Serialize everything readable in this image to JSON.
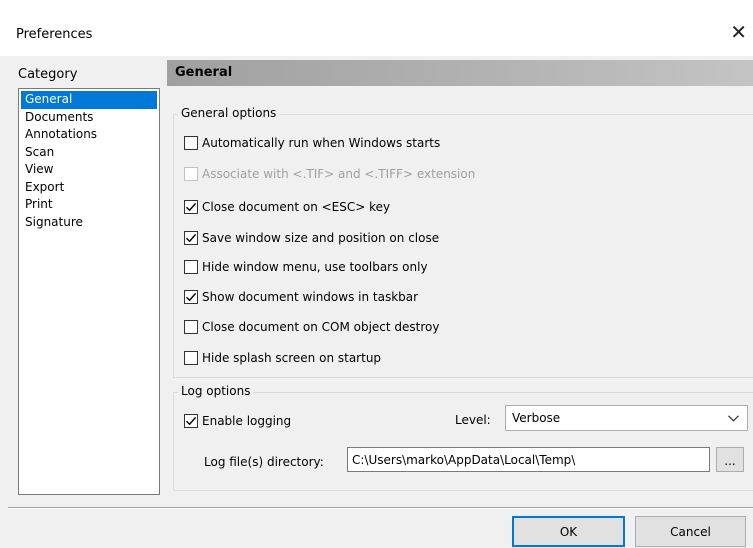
{
  "window": {
    "title": "Preferences",
    "close_glyph": "✕"
  },
  "category": {
    "label": "Category",
    "items": [
      "General",
      "Documents",
      "Annotations",
      "Scan",
      "View",
      "Export",
      "Print",
      "Signature"
    ],
    "selected_index": 0
  },
  "section": {
    "title": "General"
  },
  "general_options": {
    "legend": "General options",
    "items": [
      {
        "label": "Automatically run when Windows starts",
        "checked": false,
        "enabled": true
      },
      {
        "label": "Associate with <.TIF> and <.TIFF> extension",
        "checked": false,
        "enabled": false
      },
      {
        "label": "Close document on <ESC> key",
        "checked": true,
        "enabled": true
      },
      {
        "label": "Save window size and position on close",
        "checked": true,
        "enabled": true
      },
      {
        "label": "Hide window menu, use toolbars only",
        "checked": false,
        "enabled": true
      },
      {
        "label": "Show document windows in taskbar",
        "checked": true,
        "enabled": true
      },
      {
        "label": "Close document on COM object destroy",
        "checked": false,
        "enabled": true
      },
      {
        "label": "Hide splash screen on startup",
        "checked": false,
        "enabled": true
      }
    ]
  },
  "log_options": {
    "legend": "Log options",
    "enable_logging": {
      "label": "Enable logging",
      "checked": true
    },
    "level_label": "Level:",
    "level_value": "Verbose",
    "directory_label": "Log file(s) directory:",
    "directory_value": "C:\\Users\\marko\\AppData\\Local\\Temp\\",
    "browse_label": "..."
  },
  "buttons": {
    "ok": "OK",
    "cancel": "Cancel"
  },
  "colors": {
    "selection": "#0078d7",
    "header_gradient_start": "#a0a0a0",
    "background": "#f0f0f0"
  }
}
